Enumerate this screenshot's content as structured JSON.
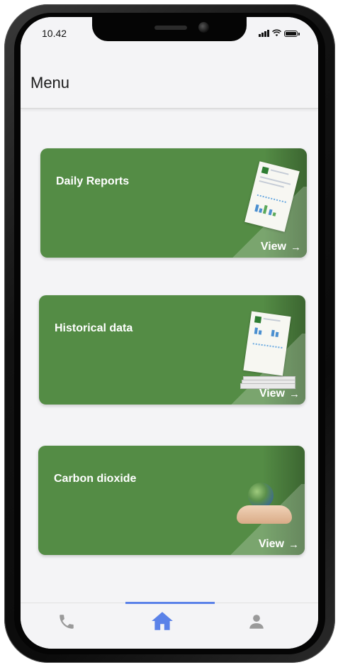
{
  "status_bar": {
    "time": "10.42"
  },
  "header": {
    "title": "Menu"
  },
  "cards": [
    {
      "title": "Daily Reports",
      "link_label": "View",
      "illustration": "report-document-icon"
    },
    {
      "title": "Historical data",
      "link_label": "View",
      "illustration": "document-stack-icon"
    },
    {
      "title": "Carbon dioxide",
      "link_label": "View",
      "illustration": "globe-in-hand-icon"
    }
  ],
  "tab_bar": {
    "items": [
      {
        "icon": "phone-icon",
        "active": false
      },
      {
        "icon": "home-icon",
        "active": true
      },
      {
        "icon": "person-icon",
        "active": false
      }
    ]
  },
  "colors": {
    "card_green": "#548c45",
    "active_tab": "#5b82e8",
    "inactive_tab": "#9a9a9a",
    "background": "#f4f4f6"
  }
}
